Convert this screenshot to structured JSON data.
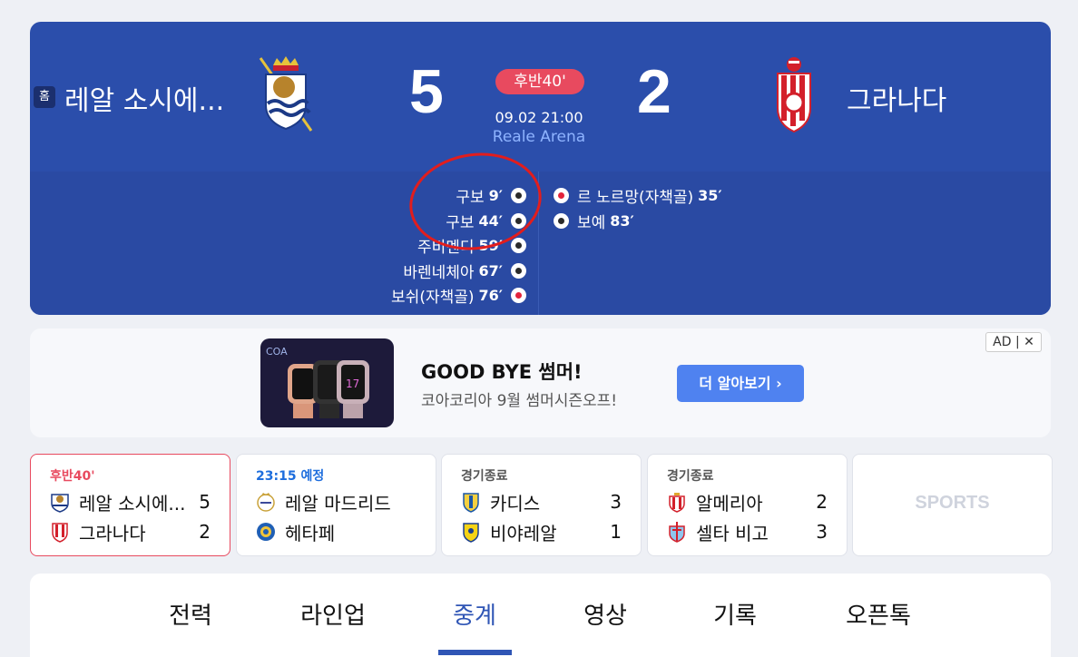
{
  "match": {
    "home_label": "홈",
    "home_team": "레알 소시에...",
    "away_team": "그라나다",
    "home_score": "5",
    "away_score": "2",
    "status": "후반40'",
    "datetime": "09.02 21:00",
    "venue": "Reale Arena"
  },
  "goals": {
    "home": [
      {
        "scorer": "구보",
        "minute": "9′"
      },
      {
        "scorer": "구보",
        "minute": "44′"
      },
      {
        "scorer": "주비멘디",
        "minute": "59′"
      },
      {
        "scorer": "바렌네체아",
        "minute": "67′"
      },
      {
        "scorer": "보쉬(자책골)",
        "minute": "76′"
      }
    ],
    "away": [
      {
        "scorer": "르 노르망(자책골)",
        "minute": "35′"
      },
      {
        "scorer": "보예",
        "minute": "83′"
      }
    ]
  },
  "ad": {
    "title": "GOOD BYE 썸머!",
    "subtitle": "코아코리아 9월 썸머시즌오프!",
    "button": "더 알아보기 ›",
    "badge": "AD | ✕",
    "brand": "COA"
  },
  "cards": [
    {
      "status": "후반40'",
      "team1": "레알 소시에...",
      "score1": "5",
      "team2": "그라나다",
      "score2": "2"
    },
    {
      "status": "23:15 예정",
      "team1": "레알 마드리드",
      "score1": "",
      "team2": "헤타페",
      "score2": ""
    },
    {
      "status": "경기종료",
      "team1": "카디스",
      "score1": "3",
      "team2": "비야레알",
      "score2": "1"
    },
    {
      "status": "경기종료",
      "team1": "알메리아",
      "score1": "2",
      "team2": "셀타 비고",
      "score2": "3"
    }
  ],
  "sports_logo": "SPORTS",
  "tabs": [
    "전력",
    "라인업",
    "중계",
    "영상",
    "기록",
    "오픈톡"
  ],
  "colors": {
    "primary": "#2b4eab",
    "live": "#e84a5f",
    "accent": "#2f55b5"
  }
}
